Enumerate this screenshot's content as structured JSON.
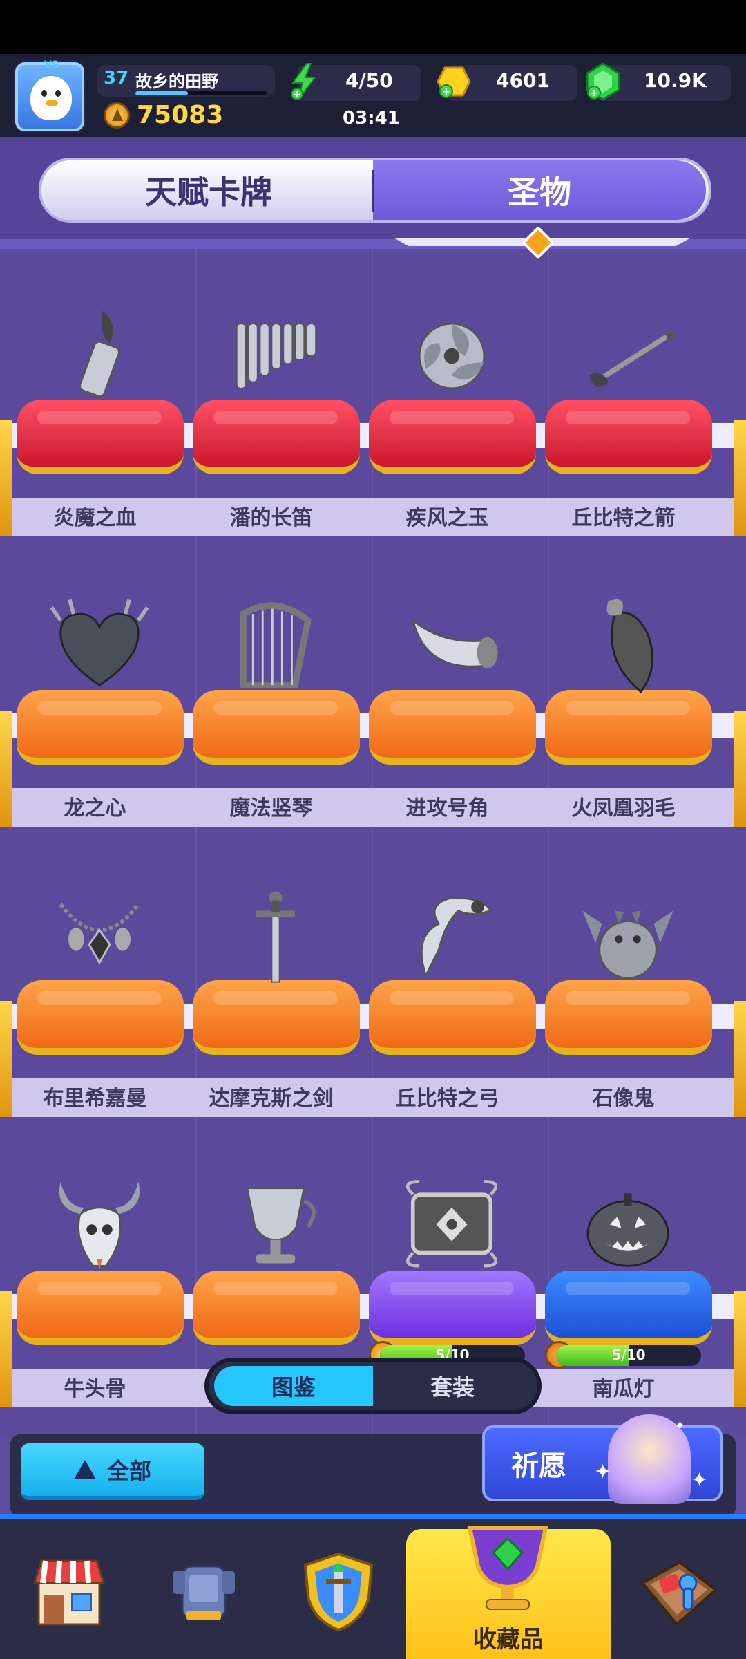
{
  "player": {
    "level": "37",
    "name": "故乡的田野",
    "trophies": "75083"
  },
  "resources": {
    "energy": "4/50",
    "energy_timer": "03:41",
    "gold": "4601",
    "gems": "10.9K"
  },
  "tabs": {
    "left": "天赋卡牌",
    "right": "圣物",
    "active": "圣物"
  },
  "relics": [
    {
      "name": "炎魔之血",
      "cushion": "red",
      "icon": "flame-vial-icon"
    },
    {
      "name": "潘的长笛",
      "cushion": "red",
      "icon": "pan-flute-icon"
    },
    {
      "name": "疾风之玉",
      "cushion": "red",
      "icon": "wind-jade-icon"
    },
    {
      "name": "丘比特之箭",
      "cushion": "red",
      "icon": "cupid-arrow-icon"
    },
    {
      "name": "龙之心",
      "cushion": "orange",
      "icon": "dragon-heart-icon"
    },
    {
      "name": "魔法竖琴",
      "cushion": "orange",
      "icon": "harp-icon"
    },
    {
      "name": "进攻号角",
      "cushion": "orange",
      "icon": "war-horn-icon"
    },
    {
      "name": "火凤凰羽毛",
      "cushion": "orange",
      "icon": "phoenix-feather-icon"
    },
    {
      "name": "布里希嘉曼",
      "cushion": "orange",
      "icon": "necklace-icon"
    },
    {
      "name": "达摩克斯之剑",
      "cushion": "orange",
      "icon": "sword-icon"
    },
    {
      "name": "丘比特之弓",
      "cushion": "orange",
      "icon": "cupid-bow-icon"
    },
    {
      "name": "石像鬼",
      "cushion": "orange",
      "icon": "gargoyle-icon"
    },
    {
      "name": "牛头骨",
      "cushion": "orange",
      "icon": "bull-skull-icon"
    },
    {
      "name": "",
      "cushion": "orange",
      "icon": "chalice-icon"
    },
    {
      "name": "",
      "cushion": "purple",
      "icon": "ornate-mirror-icon",
      "progress": "5/10",
      "progress_value": 0.5
    },
    {
      "name": "南瓜灯",
      "cushion": "blue",
      "icon": "pumpkin-lantern-icon",
      "progress": "5/10",
      "progress_value": 0.5
    }
  ],
  "view_toggle": {
    "left": "图鉴",
    "right": "套装",
    "active": "图鉴"
  },
  "filter": {
    "all_label": "全部",
    "wish_label": "祈愿"
  },
  "bottom_nav": {
    "items": [
      "shop-icon",
      "armor-icon",
      "shield-sword-icon",
      "chalice-trophy-icon",
      "board-game-icon"
    ],
    "active_label": "收藏品"
  },
  "colors": {
    "background": "#5b4a9c",
    "accent_cyan": "#25c7ff",
    "gold": "#ffd64a"
  }
}
